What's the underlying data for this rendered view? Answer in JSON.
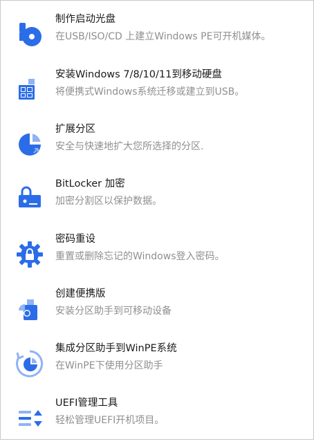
{
  "colors": {
    "icon_primary": "#2b6de8",
    "icon_light": "#8fb3f3",
    "title": "#1a1a1a",
    "description": "#8f8f8f"
  },
  "menu": {
    "items": [
      {
        "title": "制作启动光盘",
        "description": "在USB/ISO/CD 上建立Windows PE可开机媒体。",
        "icon": "bootable-disc-icon"
      },
      {
        "title": "安装Windows 7/8/10/11到移动硬盘",
        "description": "将便携式Windows系统迁移或建立到USB。",
        "icon": "windows-to-go-icon"
      },
      {
        "title": "扩展分区",
        "description": "安全与快速地扩大您所选择的分区.",
        "icon": "extend-partition-icon"
      },
      {
        "title": "BitLocker 加密",
        "description": "加密分割区以保护数据。",
        "icon": "bitlocker-lock-icon"
      },
      {
        "title": "密码重设",
        "description": "重置或删除忘记的Windows登入密码。",
        "icon": "password-reset-gear-icon"
      },
      {
        "title": "创建便携版",
        "description": "安装分区助手到可移动设备",
        "icon": "portable-version-icon"
      },
      {
        "title": "集成分区助手到WinPE系统",
        "description": "在WinPE下使用分区助手",
        "icon": "integrate-winpe-icon"
      },
      {
        "title": "UEFI管理工具",
        "description": "轻松管理UEFI开机项目。",
        "icon": "uefi-manager-icon"
      }
    ]
  }
}
